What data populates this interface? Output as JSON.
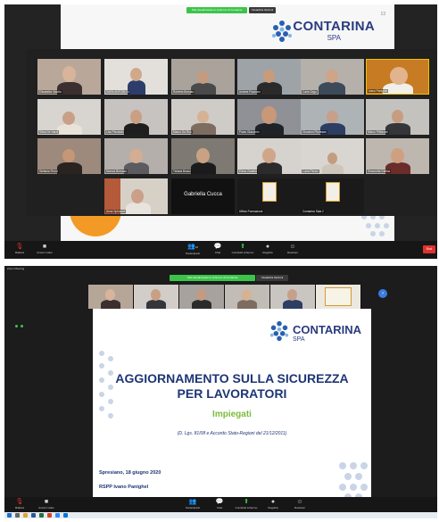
{
  "top_meeting": {
    "share_banner": "Stai visualizzando lo schermo di Contarina",
    "share_button": "Visualizza Opzioni",
    "slide": {
      "logo_name": "CONTARINA",
      "logo_suffix": "SPA",
      "page_number": "13"
    },
    "participants": [
      {
        "name": "Elisabetta Vidotto"
      },
      {
        "name": "SARA ANTONIOLI"
      },
      {
        "name": "Roberta Borsato"
      },
      {
        "name": "Andrea Fraccaro"
      },
      {
        "name": "Carla Zago"
      },
      {
        "name": "Ivano Panighel"
      },
      {
        "name": "Silvia De Nardi"
      },
      {
        "name": "Lisa Pizzolato"
      },
      {
        "name": "Mauro Da Ros"
      },
      {
        "name": "Paolo Giacomin"
      },
      {
        "name": "Giovanni Piovesan"
      },
      {
        "name": "Marco Pellizzari"
      },
      {
        "name": "Stefania Fiorot"
      },
      {
        "name": "Monica Bressan"
      },
      {
        "name": "Tiziana Bosco"
      },
      {
        "name": "Elena Zanatta"
      },
      {
        "name": "Lucia Pavan"
      },
      {
        "name": "Simonetta Gallina"
      },
      {
        "name": "Anna Spinazze"
      },
      {
        "name": "Gabriella Cucca"
      },
      {
        "name": "Ufficio Formazione"
      },
      {
        "name": "Contarina Sala 2"
      }
    ],
    "name_tile": "Gabriella Cucca",
    "toolbar": {
      "mute": "Riattiva",
      "video": "Avvia il video",
      "participants": "Partecipanti",
      "participants_count": "22",
      "chat": "Chat",
      "share": "Condividi schermo",
      "record": "Registra",
      "reactions": "Reazioni",
      "end": "Esci"
    }
  },
  "bottom_meeting": {
    "window_title": "Zoom Meeting",
    "share_banner": "Stai visualizzando lo schermo di Contarina",
    "share_button": "Visualizza Opzioni",
    "slide": {
      "logo_name": "CONTARINA",
      "logo_suffix": "SPA",
      "title_line1": "AGGIORNAMENTO SULLA SICUREZZA",
      "title_line2": "PER LAVORATORI",
      "subtitle": "Impiegati",
      "legal": "(D. Lgs. 81/08 e Accordo Stato-Regioni del 21/12/2011)",
      "place_date": "Spresiano, 18 giugno 2020",
      "rspp": "RSPP Ivano Panighel"
    },
    "toolbar": {
      "mute": "Riattiva",
      "video": "Avvia il video",
      "participants": "Partecipanti",
      "chat": "Chat",
      "share": "Condividi schermo",
      "record": "Registra",
      "reactions": "Reazioni"
    },
    "colors": {
      "title_blue": "#1e3575",
      "subtitle_green": "#7dbb3c",
      "share_green": "#3cc44a",
      "end_red": "#e0322e"
    }
  }
}
